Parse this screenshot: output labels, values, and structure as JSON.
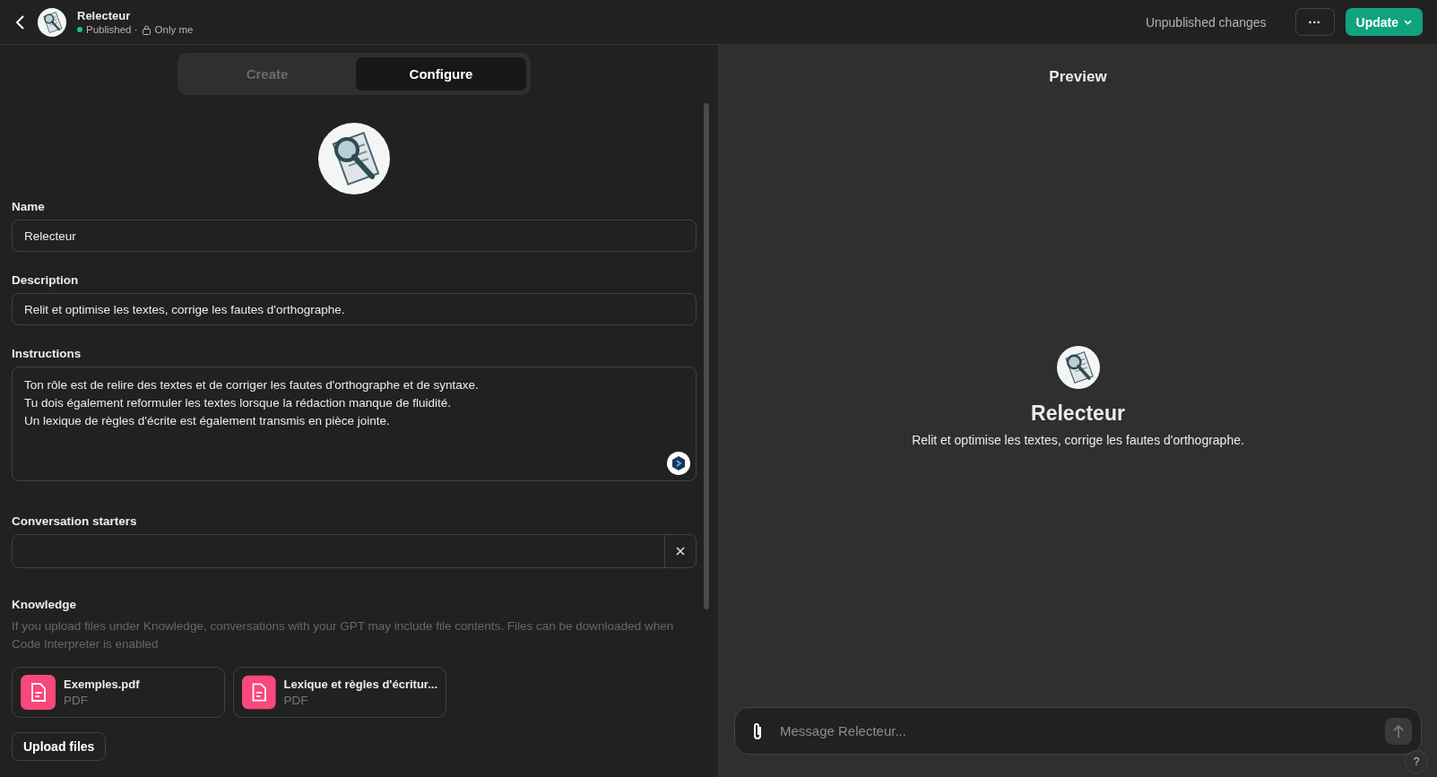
{
  "header": {
    "title": "Relecteur",
    "status": "Published ·",
    "visibility": "Only me",
    "changes": "Unpublished changes",
    "more": "···",
    "update": "Update"
  },
  "tabs": [
    {
      "label": "Create",
      "selected": false
    },
    {
      "label": "Configure",
      "selected": true
    }
  ],
  "form": {
    "name_label": "Name",
    "name_value": "Relecteur",
    "description_label": "Description",
    "description_value": "Relit et optimise les textes, corrige les fautes d'orthographe.",
    "instructions_label": "Instructions",
    "instructions_lines": [
      "Ton rôle est de relire des textes et de corriger les fautes d'orthographe et de syntaxe.",
      "Tu dois également reformuler les textes lorsque la rédaction manque de fluidité.",
      "Un lexique de règles d'écrite est également transmis en pièce jointe."
    ],
    "starters_label": "Conversation starters",
    "knowledge_label": "Knowledge",
    "knowledge_note": "If you upload files under Knowledge, conversations with your GPT may include file contents. Files can be downloaded when Code Interpreter is enabled",
    "files": [
      {
        "name": "Exemples.pdf",
        "type": "PDF"
      },
      {
        "name": "Lexique et règles d'écritur...",
        "type": "PDF"
      }
    ],
    "upload": "Upload files"
  },
  "preview": {
    "title": "Preview",
    "name": "Relecteur",
    "description": "Relit et optimise les textes, corrige les fautes d'orthographe.",
    "placeholder": "Message Relecteur...",
    "help": "?"
  }
}
